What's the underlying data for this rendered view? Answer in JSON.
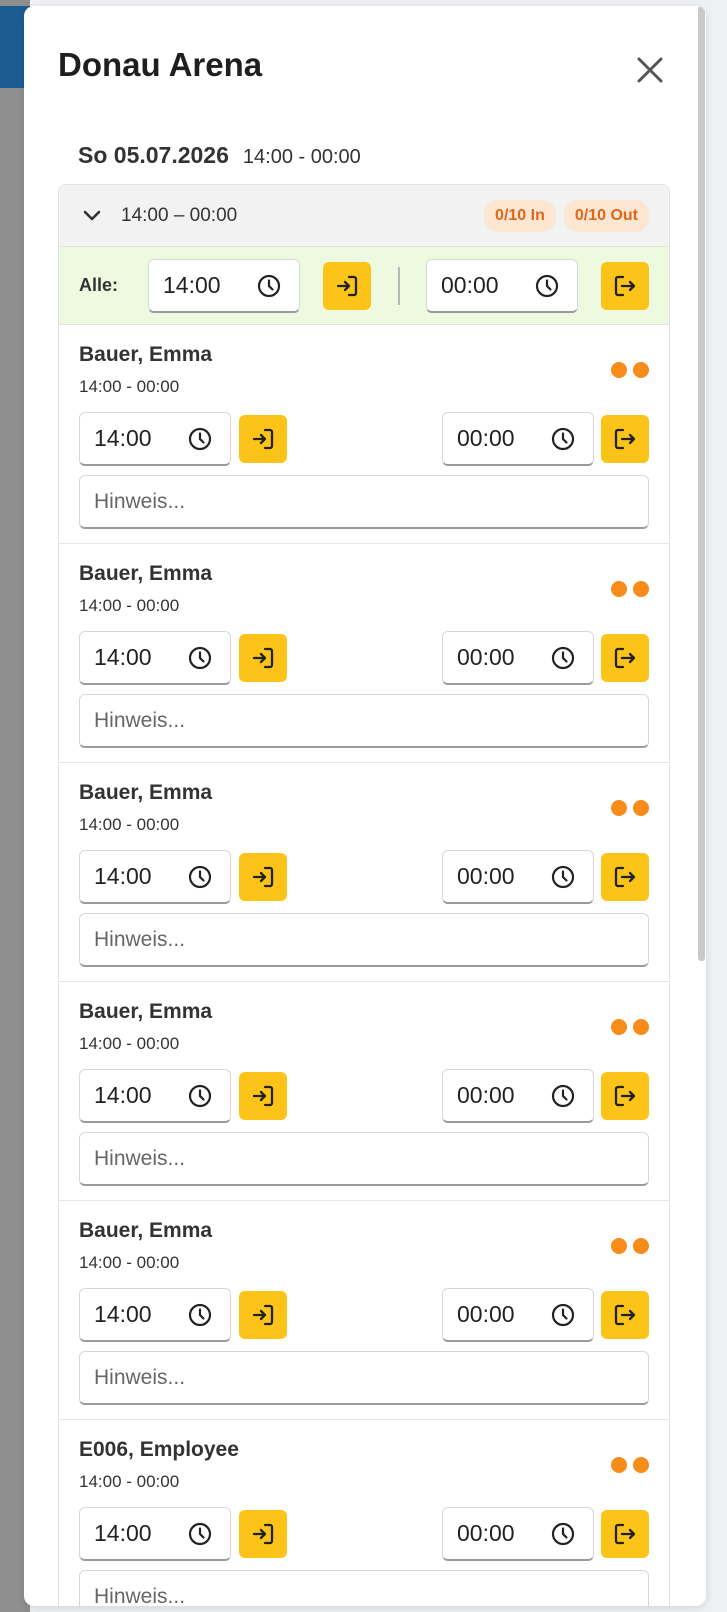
{
  "modal": {
    "title": "Donau Arena",
    "date": "So 05.07.2026",
    "date_time": "14:00 - 00:00"
  },
  "shift": {
    "range": "14:00 – 00:00",
    "badge_in": "0/10 In",
    "badge_out": "0/10 Out",
    "all_label": "Alle:",
    "all_in_time": "14:00",
    "all_out_time": "00:00"
  },
  "employees": [
    {
      "name": "Bauer, Emma",
      "time": "14:00 - 00:00",
      "in": "14:00",
      "out": "00:00",
      "note_placeholder": "Hinweis..."
    },
    {
      "name": "Bauer, Emma",
      "time": "14:00 - 00:00",
      "in": "14:00",
      "out": "00:00",
      "note_placeholder": "Hinweis..."
    },
    {
      "name": "Bauer, Emma",
      "time": "14:00 - 00:00",
      "in": "14:00",
      "out": "00:00",
      "note_placeholder": "Hinweis..."
    },
    {
      "name": "Bauer, Emma",
      "time": "14:00 - 00:00",
      "in": "14:00",
      "out": "00:00",
      "note_placeholder": "Hinweis..."
    },
    {
      "name": "Bauer, Emma",
      "time": "14:00 - 00:00",
      "in": "14:00",
      "out": "00:00",
      "note_placeholder": "Hinweis..."
    },
    {
      "name": "E006, Employee",
      "time": "14:00 - 00:00",
      "in": "14:00",
      "out": "00:00",
      "note_placeholder": "Hinweis..."
    }
  ],
  "colors": {
    "accent_button": "#fcc419",
    "status_dot": "#f78c1a",
    "badge_bg": "#fde6d2",
    "badge_text": "#e06717",
    "all_row_bg": "#eefadf"
  },
  "icons": {
    "close": "close-icon",
    "chevron": "chevron-down-icon",
    "clock": "clock-icon",
    "check_in": "login-icon",
    "check_out": "logout-icon"
  }
}
